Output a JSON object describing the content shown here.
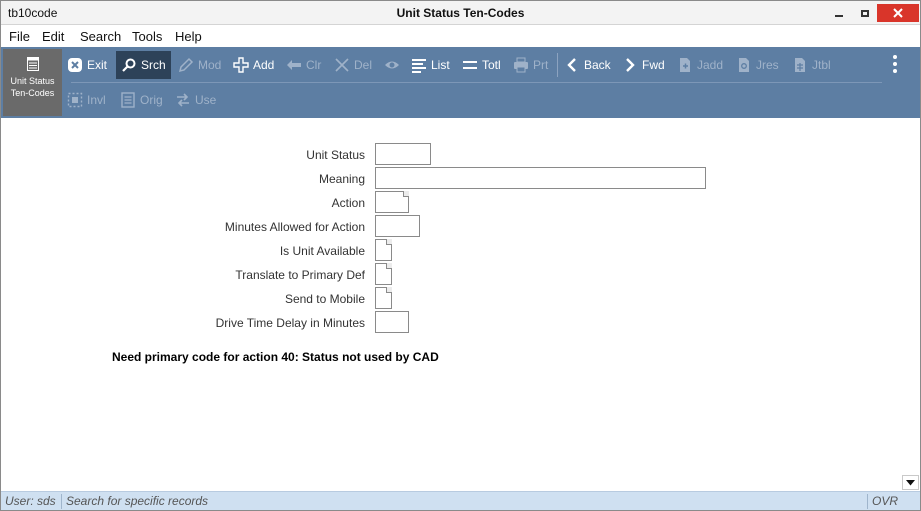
{
  "window": {
    "app_name": "tb10code",
    "title": "Unit Status Ten-Codes"
  },
  "menu": [
    "File",
    "Edit",
    "Search",
    "Tools",
    "Help"
  ],
  "form_tile": {
    "line1": "Unit Status",
    "line2": "Ten-Codes"
  },
  "toolbar": {
    "row1": [
      {
        "label": "Exit",
        "icon": "close-circle-icon",
        "state": "enabled"
      },
      {
        "label": "Srch",
        "icon": "search-icon",
        "state": "active"
      },
      {
        "label": "Mod",
        "icon": "pencil-icon",
        "state": "disabled"
      },
      {
        "label": "Add",
        "icon": "plus-icon",
        "state": "enabled"
      },
      {
        "label": "Clr",
        "icon": "undo-arrow-icon",
        "state": "disabled"
      },
      {
        "label": "Del",
        "icon": "x-icon",
        "state": "disabled"
      },
      {
        "label": "",
        "icon": "eye-icon",
        "state": "disabled"
      },
      {
        "label": "List",
        "icon": "list-icon",
        "state": "enabled"
      },
      {
        "label": "Totl",
        "icon": "equals-icon",
        "state": "enabled"
      },
      {
        "label": "Prt",
        "icon": "printer-icon",
        "state": "disabled"
      },
      {
        "label": "Back",
        "icon": "chevron-left-icon",
        "state": "enabled"
      },
      {
        "label": "Fwd",
        "icon": "chevron-right-icon",
        "state": "enabled"
      },
      {
        "label": "Jadd",
        "icon": "doc-add-icon",
        "state": "disabled"
      },
      {
        "label": "Jres",
        "icon": "doc-search-icon",
        "state": "disabled"
      },
      {
        "label": "Jtbl",
        "icon": "doc-table-icon",
        "state": "disabled"
      }
    ],
    "row2": [
      {
        "label": "Invl",
        "icon": "dashed-box-icon",
        "state": "disabled"
      },
      {
        "label": "Orig",
        "icon": "document-icon",
        "state": "disabled"
      },
      {
        "label": "Use",
        "icon": "swap-arrows-icon",
        "state": "disabled"
      }
    ]
  },
  "form": {
    "fields": [
      {
        "label": "Unit Status",
        "value": ""
      },
      {
        "label": "Meaning",
        "value": ""
      },
      {
        "label": "Action",
        "value": ""
      },
      {
        "label": "Minutes Allowed for Action",
        "value": ""
      },
      {
        "label": "Is Unit Available",
        "value": ""
      },
      {
        "label": "Translate to Primary Def",
        "value": ""
      },
      {
        "label": "Send to Mobile",
        "value": ""
      },
      {
        "label": "Drive Time Delay in Minutes",
        "value": ""
      }
    ],
    "message": "Need primary code for action 40: Status not used by CAD"
  },
  "status": {
    "user": "User: sds",
    "message": "Search for specific records",
    "mode": "OVR"
  },
  "colors": {
    "toolbar_bg": "#5d7ea3",
    "active_button": "#2d4259",
    "close_button": "#d9352a",
    "statusbar_bg": "#cfe0f1"
  }
}
